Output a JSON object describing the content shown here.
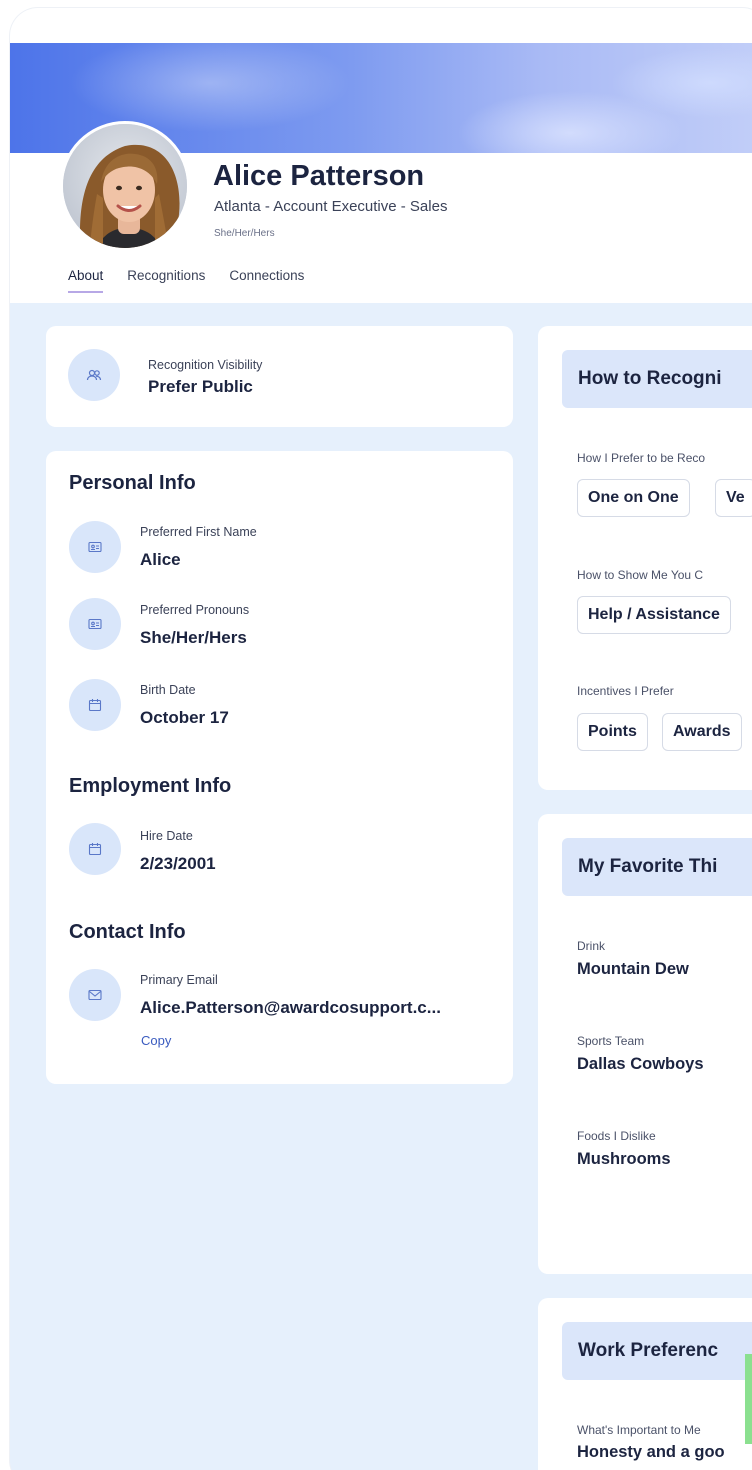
{
  "profile": {
    "name": "Alice Patterson",
    "subtitle": "Atlanta - Account Executive - Sales",
    "pronouns": "She/Her/Hers"
  },
  "tabs": [
    {
      "label": "About",
      "active": true
    },
    {
      "label": "Recognitions",
      "active": false
    },
    {
      "label": "Connections",
      "active": false
    }
  ],
  "visibility": {
    "label": "Recognition Visibility",
    "value": "Prefer Public",
    "icon": "users-icon"
  },
  "personal": {
    "title": "Personal Info",
    "first_name": {
      "label": "Preferred First Name",
      "value": "Alice",
      "icon": "id-card-icon"
    },
    "pronouns": {
      "label": "Preferred Pronouns",
      "value": "She/Her/Hers",
      "icon": "id-card-icon"
    },
    "birth_date": {
      "label": "Birth Date",
      "value": "October 17",
      "icon": "calendar-icon"
    }
  },
  "employment": {
    "title": "Employment Info",
    "hire_date": {
      "label": "Hire Date",
      "value": "2/23/2001",
      "icon": "calendar-icon"
    }
  },
  "contact": {
    "title": "Contact Info",
    "email": {
      "label": "Primary Email",
      "value": "Alice.Patterson@awardcosupport.c...",
      "icon": "mail-icon"
    },
    "copy_label": "Copy"
  },
  "recognize": {
    "title": "How to Recogni",
    "prefer_label": "How I Prefer to be Reco",
    "prefer_chips": [
      "One on One",
      "Ve"
    ],
    "show_label": "How to Show Me You C",
    "show_chips": [
      "Help / Assistance"
    ],
    "incentives_label": "Incentives I Prefer",
    "incentives_chips": [
      "Points",
      "Awards"
    ]
  },
  "favorites": {
    "title": "My Favorite Thi",
    "drink_label": "Drink",
    "drink_value": "Mountain Dew",
    "team_label": "Sports Team",
    "team_value": "Dallas Cowboys",
    "dislike_label": "Foods I Dislike",
    "dislike_value": "Mushrooms"
  },
  "work": {
    "title": "Work Preferenc",
    "important_label": "What's Important to Me",
    "important_value": "Honesty and a goo"
  },
  "colors": {
    "background": "#e6f0fc",
    "card": "#ffffff",
    "icon_bg": "#d9e6fa",
    "accent_blue": "#4d74e9",
    "tab_underline": "#b7a8e6"
  }
}
